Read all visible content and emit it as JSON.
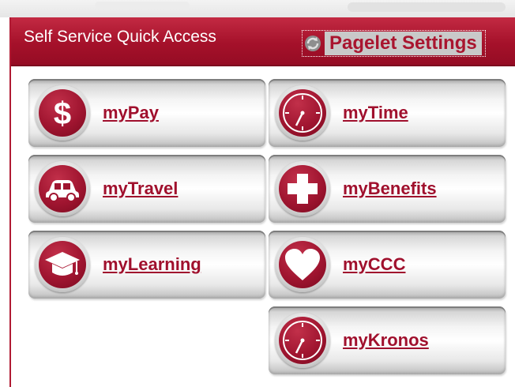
{
  "header": {
    "title": "Self Service Quick Access",
    "settings_label": "Pagelet Settings"
  },
  "tiles": [
    {
      "label": "myPay",
      "icon": "dollar-icon"
    },
    {
      "label": "myTime",
      "icon": "clock-icon"
    },
    {
      "label": "myTravel",
      "icon": "car-icon"
    },
    {
      "label": "myBenefits",
      "icon": "plus-icon"
    },
    {
      "label": "myLearning",
      "icon": "graduation-cap-icon"
    },
    {
      "label": "myCCC",
      "icon": "heart-icon"
    },
    {
      "label": "myKronos",
      "icon": "clock-icon"
    }
  ],
  "colors": {
    "brand": "#a5112a",
    "link": "#a0102d",
    "settings_bg": "#c9c9c9"
  }
}
